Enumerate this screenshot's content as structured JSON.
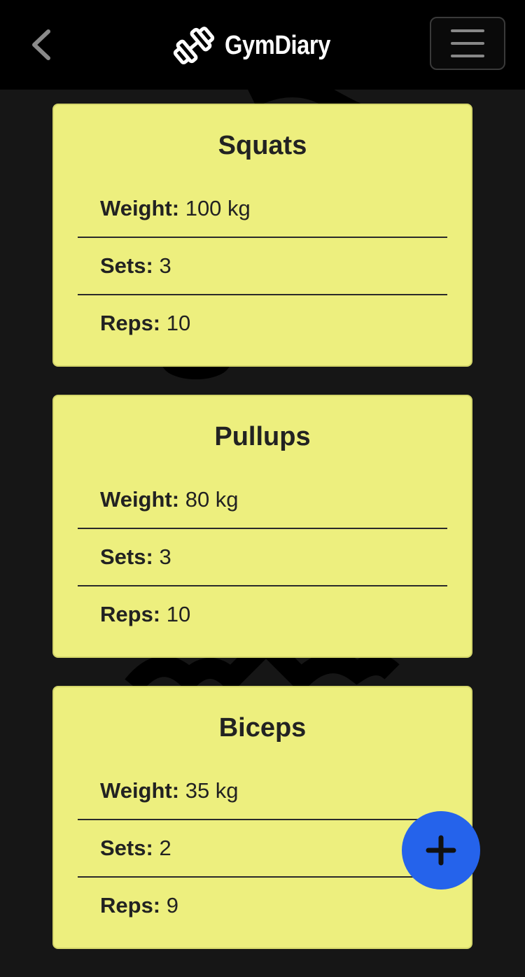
{
  "header": {
    "app_name": "GymDiary",
    "back_icon": "chevron-left-icon",
    "logo_icon": "dumbbell-icon",
    "menu_icon": "hamburger-icon"
  },
  "labels": {
    "weight": "Weight:",
    "sets": "Sets:",
    "reps": "Reps:"
  },
  "exercises": [
    {
      "name": "Squats",
      "weight": "100 kg",
      "sets": "3",
      "reps": "10"
    },
    {
      "name": "Pullups",
      "weight": "80 kg",
      "sets": "3",
      "reps": "10"
    },
    {
      "name": "Biceps",
      "weight": "35 kg",
      "sets": "2",
      "reps": "9"
    }
  ],
  "fab": {
    "icon": "plus-icon"
  },
  "colors": {
    "background": "#161616",
    "header": "#000000",
    "card": "#edef7e",
    "fab": "#2563eb"
  }
}
